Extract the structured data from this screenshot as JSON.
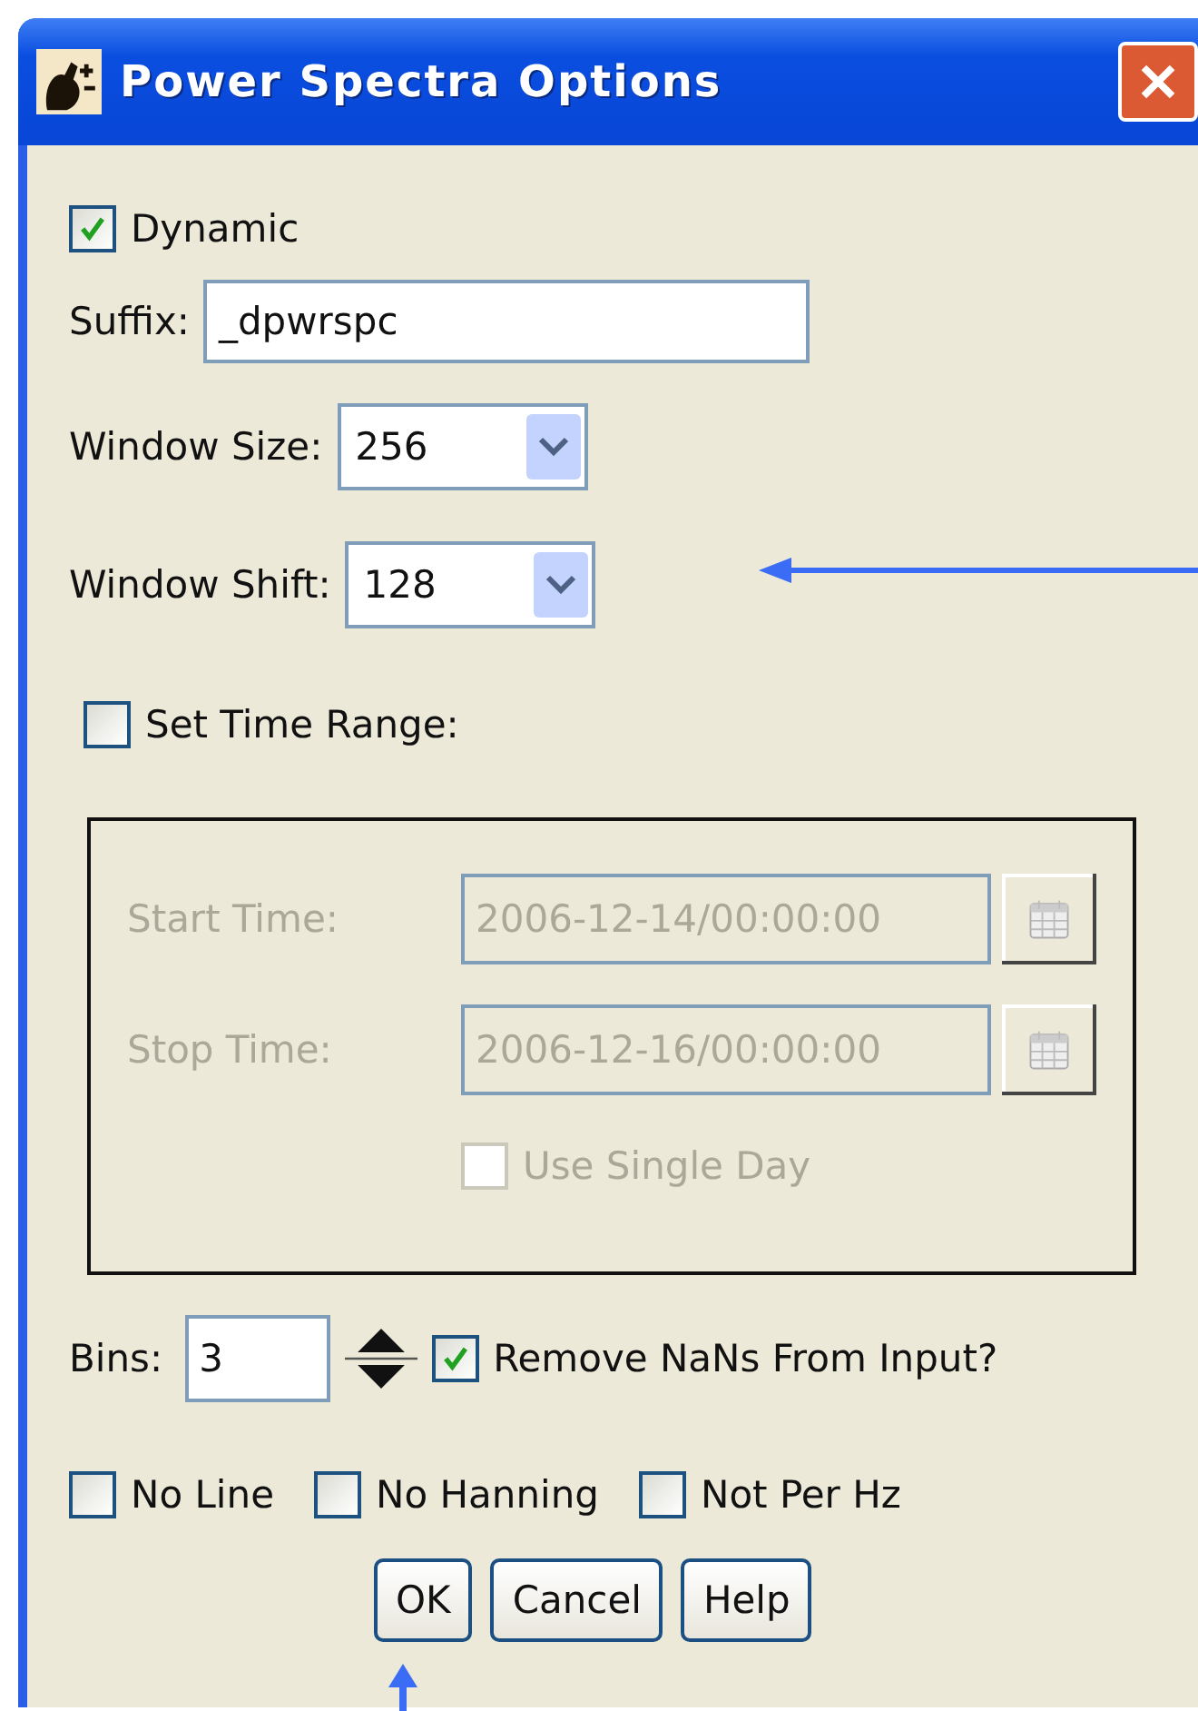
{
  "window": {
    "title": "Power Spectra Options"
  },
  "dynamic": {
    "label": "Dynamic",
    "checked": true
  },
  "suffix": {
    "label": "Suffix:",
    "value": "_dpwrspc"
  },
  "window_size": {
    "label": "Window Size:",
    "value": "256"
  },
  "window_shift": {
    "label": "Window Shift:",
    "value": "128"
  },
  "set_time_range": {
    "label": "Set Time Range:",
    "checked": false
  },
  "time_range": {
    "disabled": true,
    "fields": [
      {
        "label": "Start Time:",
        "value": "2006-12-14/00:00:00"
      },
      {
        "label": "Stop Time:",
        "value": "2006-12-16/00:00:00"
      }
    ],
    "use_single_day": {
      "label": "Use Single Day",
      "checked": false
    }
  },
  "bins": {
    "label": "Bins:",
    "value": "3"
  },
  "remove_nans": {
    "label": "Remove NaNs From Input?",
    "checked": true
  },
  "options": [
    {
      "label": "No Line",
      "checked": false
    },
    {
      "label": "No Hanning",
      "checked": false
    },
    {
      "label": "Not Per Hz",
      "checked": false
    }
  ],
  "buttons": [
    {
      "label": "OK"
    },
    {
      "label": "Cancel"
    },
    {
      "label": "Help"
    }
  ]
}
